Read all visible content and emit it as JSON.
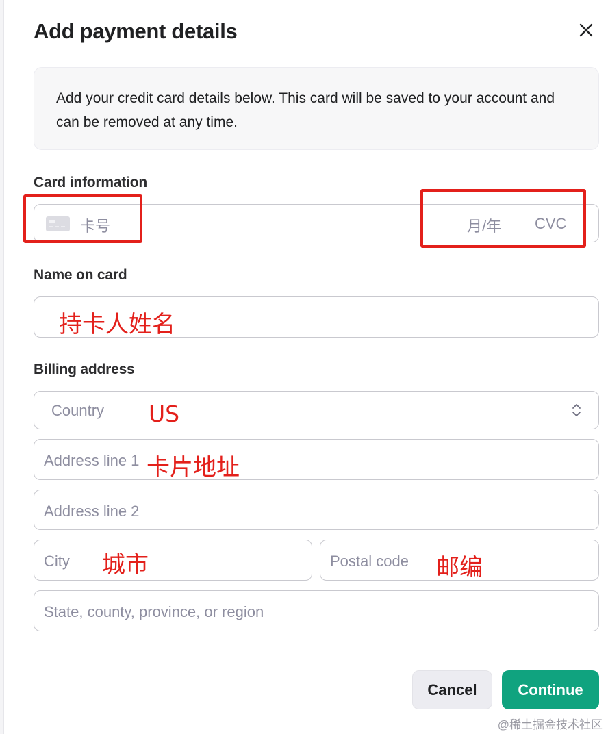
{
  "dialog": {
    "title": "Add payment details",
    "info_text": "Add your credit card details below. This card will be saved to your account and can be removed at any time."
  },
  "card_info": {
    "label": "Card information",
    "number_placeholder": "卡号",
    "expiry_placeholder": "月/年",
    "cvc_placeholder": "CVC"
  },
  "name_section": {
    "label": "Name on card",
    "annotation": "持卡人姓名"
  },
  "billing": {
    "label": "Billing address",
    "country_placeholder": "Country",
    "country_annotation": "US",
    "address1_placeholder": "Address line 1",
    "address1_annotation": "卡片地址",
    "address2_placeholder": "Address line 2",
    "city_placeholder": "City",
    "city_annotation": "城市",
    "postal_placeholder": "Postal code",
    "postal_annotation": "邮编",
    "state_placeholder": "State, county, province, or region"
  },
  "buttons": {
    "cancel": "Cancel",
    "continue": "Continue"
  },
  "watermark": "@稀土掘金技术社区",
  "colors": {
    "accent": "#10a37f",
    "annotation_red": "#e3201b",
    "info_bg": "#f7f7f8"
  }
}
